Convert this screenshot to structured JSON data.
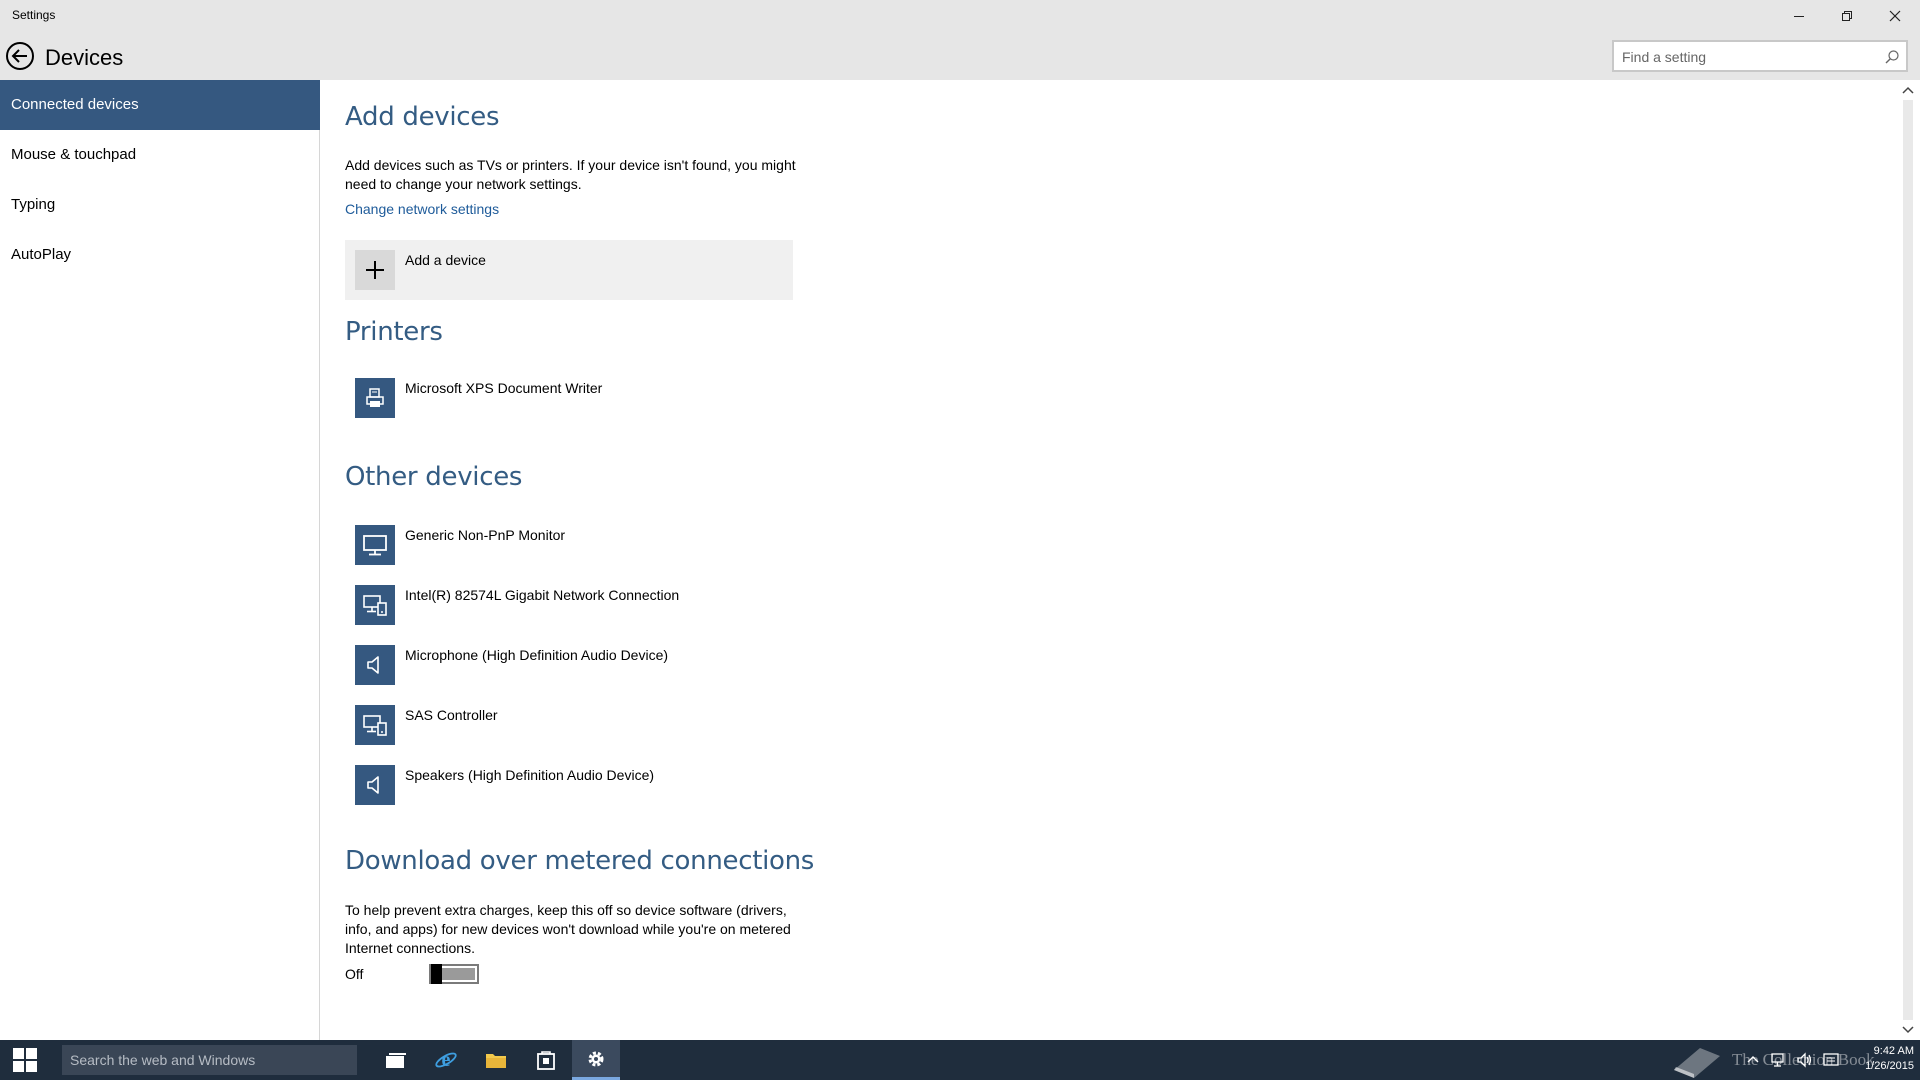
{
  "window": {
    "app_title": "Settings"
  },
  "header": {
    "title": "Devices",
    "search_placeholder": "Find a setting"
  },
  "sidebar": {
    "items": [
      {
        "label": "Connected devices",
        "active": true
      },
      {
        "label": "Mouse & touchpad",
        "active": false
      },
      {
        "label": "Typing",
        "active": false
      },
      {
        "label": "AutoPlay",
        "active": false
      }
    ]
  },
  "main": {
    "add_devices": {
      "heading": "Add devices",
      "description": "Add devices such as TVs or printers. If your device isn't found, you might need to change your network settings.",
      "link": "Change network settings",
      "add_button_label": "Add a device"
    },
    "printers": {
      "heading": "Printers",
      "items": [
        {
          "name": "Microsoft XPS Document Writer",
          "icon": "printer-icon"
        }
      ]
    },
    "other_devices": {
      "heading": "Other devices",
      "items": [
        {
          "name": "Generic Non-PnP Monitor",
          "icon": "monitor-icon"
        },
        {
          "name": "Intel(R) 82574L Gigabit Network Connection",
          "icon": "network-device-icon"
        },
        {
          "name": "Microphone (High Definition Audio Device)",
          "icon": "speaker-icon"
        },
        {
          "name": "SAS Controller",
          "icon": "network-device-icon"
        },
        {
          "name": "Speakers (High Definition Audio Device)",
          "icon": "speaker-icon"
        }
      ]
    },
    "metered": {
      "heading": "Download over metered connections",
      "description": "To help prevent extra charges, keep this off so device software (drivers, info, and apps) for new devices won't download while you're on metered Internet connections.",
      "toggle_label": "Off",
      "toggle_state": false
    }
  },
  "taskbar": {
    "search_placeholder": "Search the web and Windows",
    "clock_time": "9:42 AM",
    "clock_date": "1/26/2015",
    "watermark_text": "The Collection Book"
  },
  "colors": {
    "accent": "#355880",
    "heading": "#345c83",
    "link": "#1e5b9a",
    "taskbar": "#1f2d3d",
    "chrome": "#e6e6e6"
  }
}
